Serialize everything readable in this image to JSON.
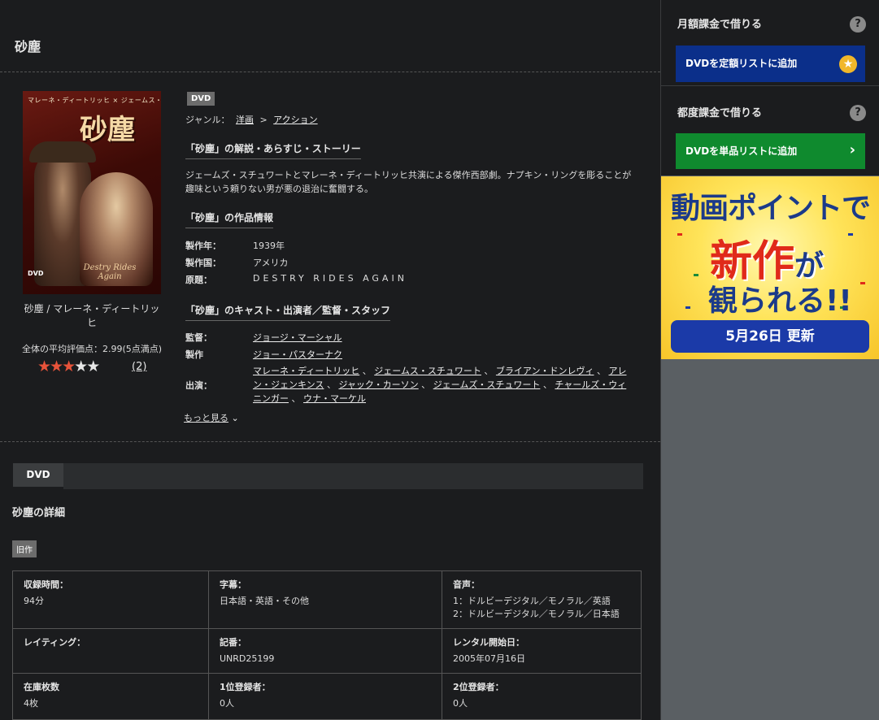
{
  "page": {
    "title": "砂塵"
  },
  "poster": {
    "header": "マレーネ・ディートリッヒ × ジェームス・スチュワート",
    "title": "砂塵",
    "subtitle": "Destry Rides Again",
    "dvd_mark": "DVD"
  },
  "product": {
    "caption": "砂塵 / マレーネ・ディートリッヒ",
    "avg_rating_text": "全体の平均評価点：2.99(5点満点)",
    "rating": 2.99,
    "rating_max": 5,
    "review_count": "(2)",
    "media_badge": "DVD"
  },
  "genre": {
    "label": "ジャンル：",
    "items": [
      "洋画",
      "アクション"
    ],
    "separator": ">"
  },
  "story": {
    "heading": "「砂塵」の解説・あらすじ・ストーリー",
    "text": "ジェームズ・スチュワートとマレーネ・ディートリッヒ共演による傑作西部劇。ナプキン・リングを彫ることが趣味という頼りない男が悪の退治に奮闘する。"
  },
  "work_info": {
    "heading": "「砂塵」の作品情報",
    "rows": [
      {
        "label": "製作年：",
        "value": "1939年"
      },
      {
        "label": "製作国：",
        "value": "アメリカ"
      },
      {
        "label": "原題：",
        "value": "DESTRY RIDES AGAIN"
      }
    ]
  },
  "cast": {
    "heading": "「砂塵」のキャスト・出演者／監督・スタッフ",
    "director_label": "監督：",
    "director": "ジョージ・マーシャル",
    "producer_label": "製作",
    "producer": "ジョー・パスターナク",
    "actors_label": "出演：",
    "actors": [
      "マレーネ・ディートリッヒ",
      "ジェームス・スチュワート",
      "ブライアン・ドンレヴィ",
      "アレン・ジェンキンス",
      "ジャック・カーソン",
      "ジェームズ・スチュワート",
      "チャールズ・ウィニンガー",
      "ウナ・マーケル"
    ],
    "more_label": "もっと見る"
  },
  "tabs": [
    {
      "label": "DVD"
    }
  ],
  "details": {
    "heading": "砂塵の詳細",
    "badge": "旧作",
    "cells": [
      {
        "label": "収録時間：",
        "lines": [
          "94分"
        ]
      },
      {
        "label": "字幕：",
        "lines": [
          "日本語・英語・その他"
        ]
      },
      {
        "label": "音声：",
        "lines": [
          "1：ドルビーデジタル／モノラル／英語",
          "2：ドルビーデジタル／モノラル／日本語"
        ]
      },
      {
        "label": "レイティング：",
        "lines": []
      },
      {
        "label": "記番：",
        "lines": [
          "UNRD25199"
        ]
      },
      {
        "label": "レンタル開始日：",
        "lines": [
          "2005年07月16日"
        ]
      },
      {
        "label": "在庫枚数",
        "lines": [
          "4枚"
        ]
      },
      {
        "label": "1位登録者：",
        "lines": [
          "0人"
        ]
      },
      {
        "label": "2位登録者：",
        "lines": [
          "0人"
        ]
      }
    ]
  },
  "sidebar": {
    "monthly": {
      "title": "月額課金で借りる",
      "help": "?",
      "button": "DVDを定額リストに追加",
      "button_icon": "star-icon"
    },
    "single": {
      "title": "都度課金で借りる",
      "help": "?",
      "button": "DVDを単品リストに追加",
      "button_icon": "chevron-right-icon"
    }
  },
  "promo": {
    "line1": "動画ポイントで",
    "line2": "新作",
    "line2_suffix": "が",
    "line3": "観られる!!",
    "bar": "5月26日 更新"
  },
  "colors": {
    "background": "#1b1c1e",
    "star_on": "#e8533a",
    "monthly_button": "#0b2f8a",
    "single_button": "#0f8a2e",
    "promo_blue": "#1b3aa8"
  }
}
